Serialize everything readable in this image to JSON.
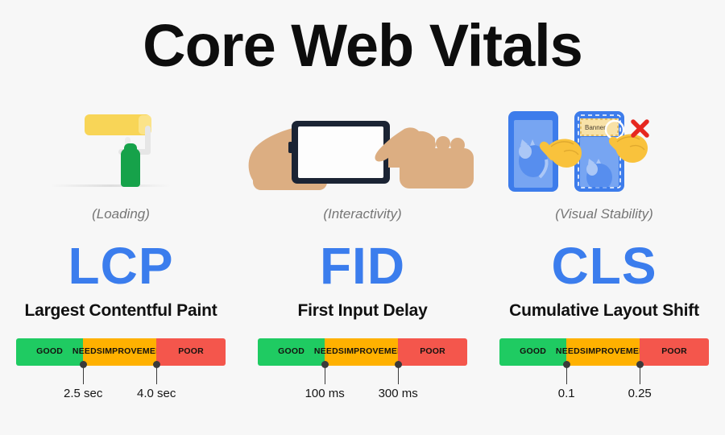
{
  "title": "Core Web Vitals",
  "background_color": "#f7f7f7",
  "accent_color": "#3b7ded",
  "threshold_colors": {
    "good": "#1fcb62",
    "needs_improvement": "#ffb100",
    "poor": "#f4564c"
  },
  "rating_labels": {
    "good": "GOOD",
    "needs_improvement_line1": "NEEDS",
    "needs_improvement_line2": "IMPROVEMENT",
    "poor": "POOR"
  },
  "metrics": [
    {
      "icon": "paint-roller-icon",
      "caption": "(Loading)",
      "acronym": "LCP",
      "full_name": "Largest Contentful Paint",
      "thresholds": [
        "2.5 sec",
        "4.0 sec"
      ],
      "segments": [
        {
          "rating": "good",
          "label": "GOOD",
          "width_pct": 32
        },
        {
          "rating": "needs",
          "label": "NEEDS IMPROVEMENT",
          "width_pct": 35
        },
        {
          "rating": "poor",
          "label": "POOR",
          "width_pct": 33
        }
      ]
    },
    {
      "icon": "hands-phone-tap-icon",
      "caption": "(Interactivity)",
      "acronym": "FID",
      "full_name": "First Input Delay",
      "thresholds": [
        "100 ms",
        "300 ms"
      ],
      "segments": [
        {
          "rating": "good",
          "label": "GOOD",
          "width_pct": 32
        },
        {
          "rating": "needs",
          "label": "NEEDS IMPROVEMENT",
          "width_pct": 35
        },
        {
          "rating": "poor",
          "label": "POOR",
          "width_pct": 33
        }
      ]
    },
    {
      "icon": "shifting-banner-phones-icon",
      "caption": "(Visual Stability)",
      "acronym": "CLS",
      "full_name": "Cumulative Layout Shift",
      "thresholds": [
        "0.1",
        "0.25"
      ],
      "segments": [
        {
          "rating": "good",
          "label": "GOOD",
          "width_pct": 32
        },
        {
          "rating": "needs",
          "label": "NEEDS IMPROVEMENT",
          "width_pct": 35
        },
        {
          "rating": "poor",
          "label": "POOR",
          "width_pct": 33
        }
      ]
    }
  ],
  "cls_icon_text": "Banner"
}
